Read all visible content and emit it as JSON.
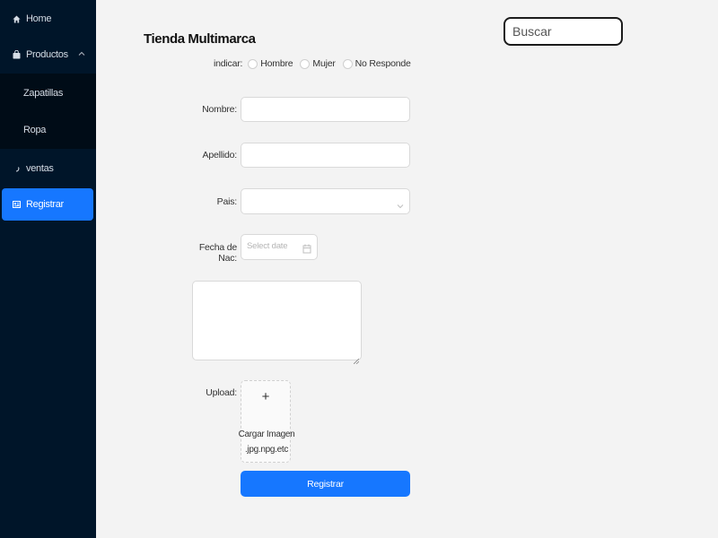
{
  "sidebar": {
    "items": [
      {
        "label": "Home",
        "icon": "home-icon"
      },
      {
        "label": "Productos",
        "icon": "bag-icon"
      },
      {
        "label": "Zapatillas"
      },
      {
        "label": "Ropa"
      },
      {
        "label": "ventas",
        "icon": "loading-icon"
      },
      {
        "label": "Registrar",
        "icon": "id-card-icon",
        "selected": true
      }
    ]
  },
  "search": {
    "placeholder": "Buscar"
  },
  "form": {
    "title": "Tienda Multimarca",
    "gender": {
      "label": "indicar:",
      "options": [
        "Hombre",
        "Mujer",
        "No Responde"
      ]
    },
    "nombre_label": "Nombre:",
    "apellido_label": "Apellido:",
    "pais_label": "Pais:",
    "fecha_label": "Fecha de Nac:",
    "fecha_placeholder": "Select date",
    "upload_label": "Upload:",
    "upload": {
      "plus": "+",
      "line1": "Cargar Imagen",
      "line2": ".jpg.npg.etc"
    },
    "submit_label": "Registrar"
  },
  "colors": {
    "sidebar_bg": "#001529",
    "submenu_bg": "#000c17",
    "primary": "#1677ff",
    "page_bg": "#f3f3f3"
  }
}
